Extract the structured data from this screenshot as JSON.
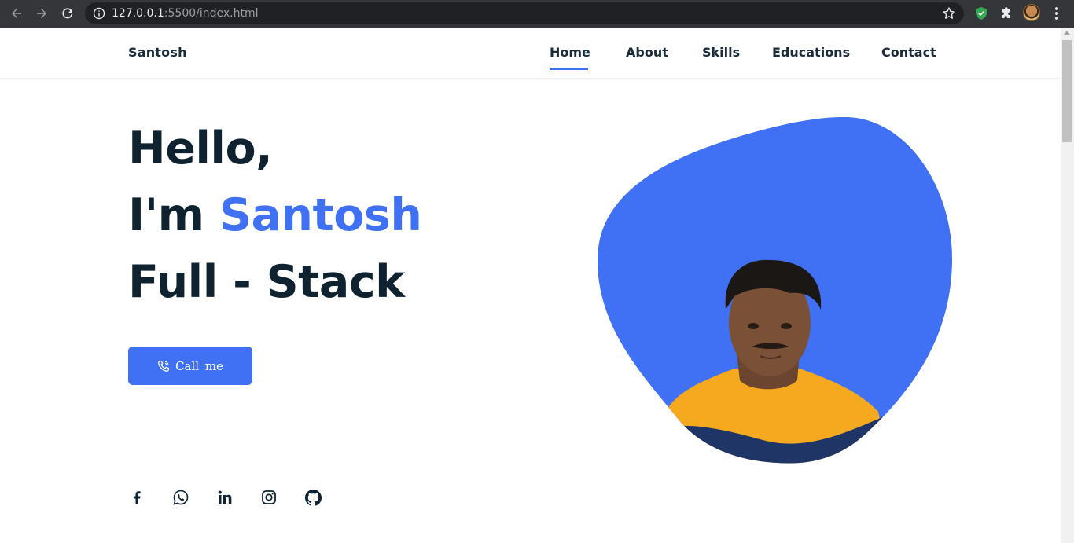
{
  "browser": {
    "url_host": "127.0.0.1",
    "url_rest": ":5500/index.html",
    "icons": [
      "back-icon",
      "forward-icon",
      "reload-icon",
      "info-icon",
      "star-icon",
      "shield-extension-icon",
      "puzzle-icon",
      "profile-avatar",
      "kebab-menu-icon"
    ]
  },
  "header": {
    "logo": "Santosh",
    "nav": [
      {
        "label": "Home",
        "active": true
      },
      {
        "label": "About",
        "active": false
      },
      {
        "label": "Skills",
        "active": false
      },
      {
        "label": "Educations",
        "active": false
      },
      {
        "label": "Contact",
        "active": false
      }
    ]
  },
  "hero": {
    "line1": "Hello,",
    "line2_prefix": "I'm ",
    "line2_name": "Santosh",
    "line3": "Full - Stack",
    "button_label": "Call me"
  },
  "social": [
    "facebook-icon",
    "whatsapp-icon",
    "linkedin-icon",
    "instagram-icon",
    "github-icon"
  ],
  "colors": {
    "accent": "#4070f4",
    "heading": "#0f2230",
    "chrome": "#35363a"
  }
}
